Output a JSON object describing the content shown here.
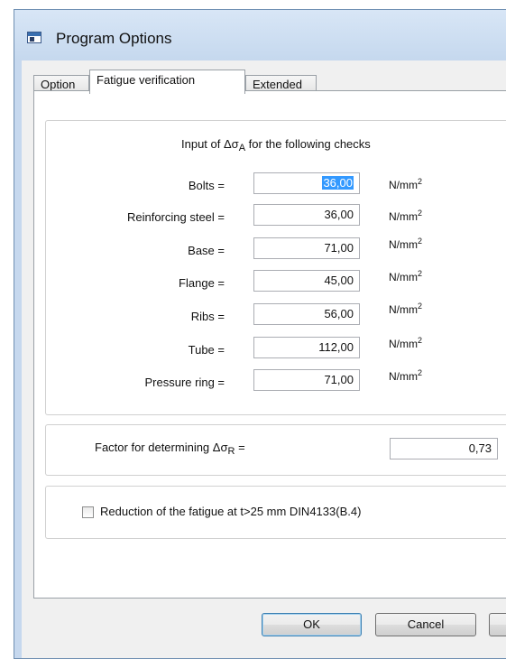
{
  "window": {
    "title": "Program Options"
  },
  "tabs": [
    "Option",
    "Fatigue verification",
    "Extended"
  ],
  "active_tab": "Fatigue verification",
  "checks_group": {
    "heading_prefix": "Input of ",
    "heading_symbol": "Δσ",
    "heading_subscript": "A",
    "heading_suffix": " for the following checks",
    "rows": [
      {
        "label": "Bolts =",
        "value": "36,00",
        "unit": "N/mm",
        "unit_sup": "2"
      },
      {
        "label": "Reinforcing steel =",
        "value": "36,00",
        "unit": "N/mm",
        "unit_sup": "2"
      },
      {
        "label": "Base =",
        "value": "71,00",
        "unit": "N/mm",
        "unit_sup": "2"
      },
      {
        "label": "Flange =",
        "value": "45,00",
        "unit": "N/mm",
        "unit_sup": "2"
      },
      {
        "label": "Ribs =",
        "value": "56,00",
        "unit": "N/mm",
        "unit_sup": "2"
      },
      {
        "label": "Tube =",
        "value": "112,00",
        "unit": "N/mm",
        "unit_sup": "2"
      },
      {
        "label": "Pressure ring =",
        "value": "71,00",
        "unit": "N/mm",
        "unit_sup": "2"
      }
    ]
  },
  "factor_group": {
    "label_prefix": "Factor for determining  ",
    "label_symbol": "Δσ",
    "label_subscript": "R",
    "label_suffix": "  =",
    "value": "0,73"
  },
  "reduction": {
    "label": "Reduction of the fatigue at t>25 mm DIN4133(B.4)",
    "checked": false
  },
  "buttons": {
    "ok": "OK",
    "cancel": "Cancel"
  },
  "colors": {
    "title_bar": "#c5d8ee",
    "selection": "#3399ff",
    "default_button_border": "#3c7fb1"
  }
}
